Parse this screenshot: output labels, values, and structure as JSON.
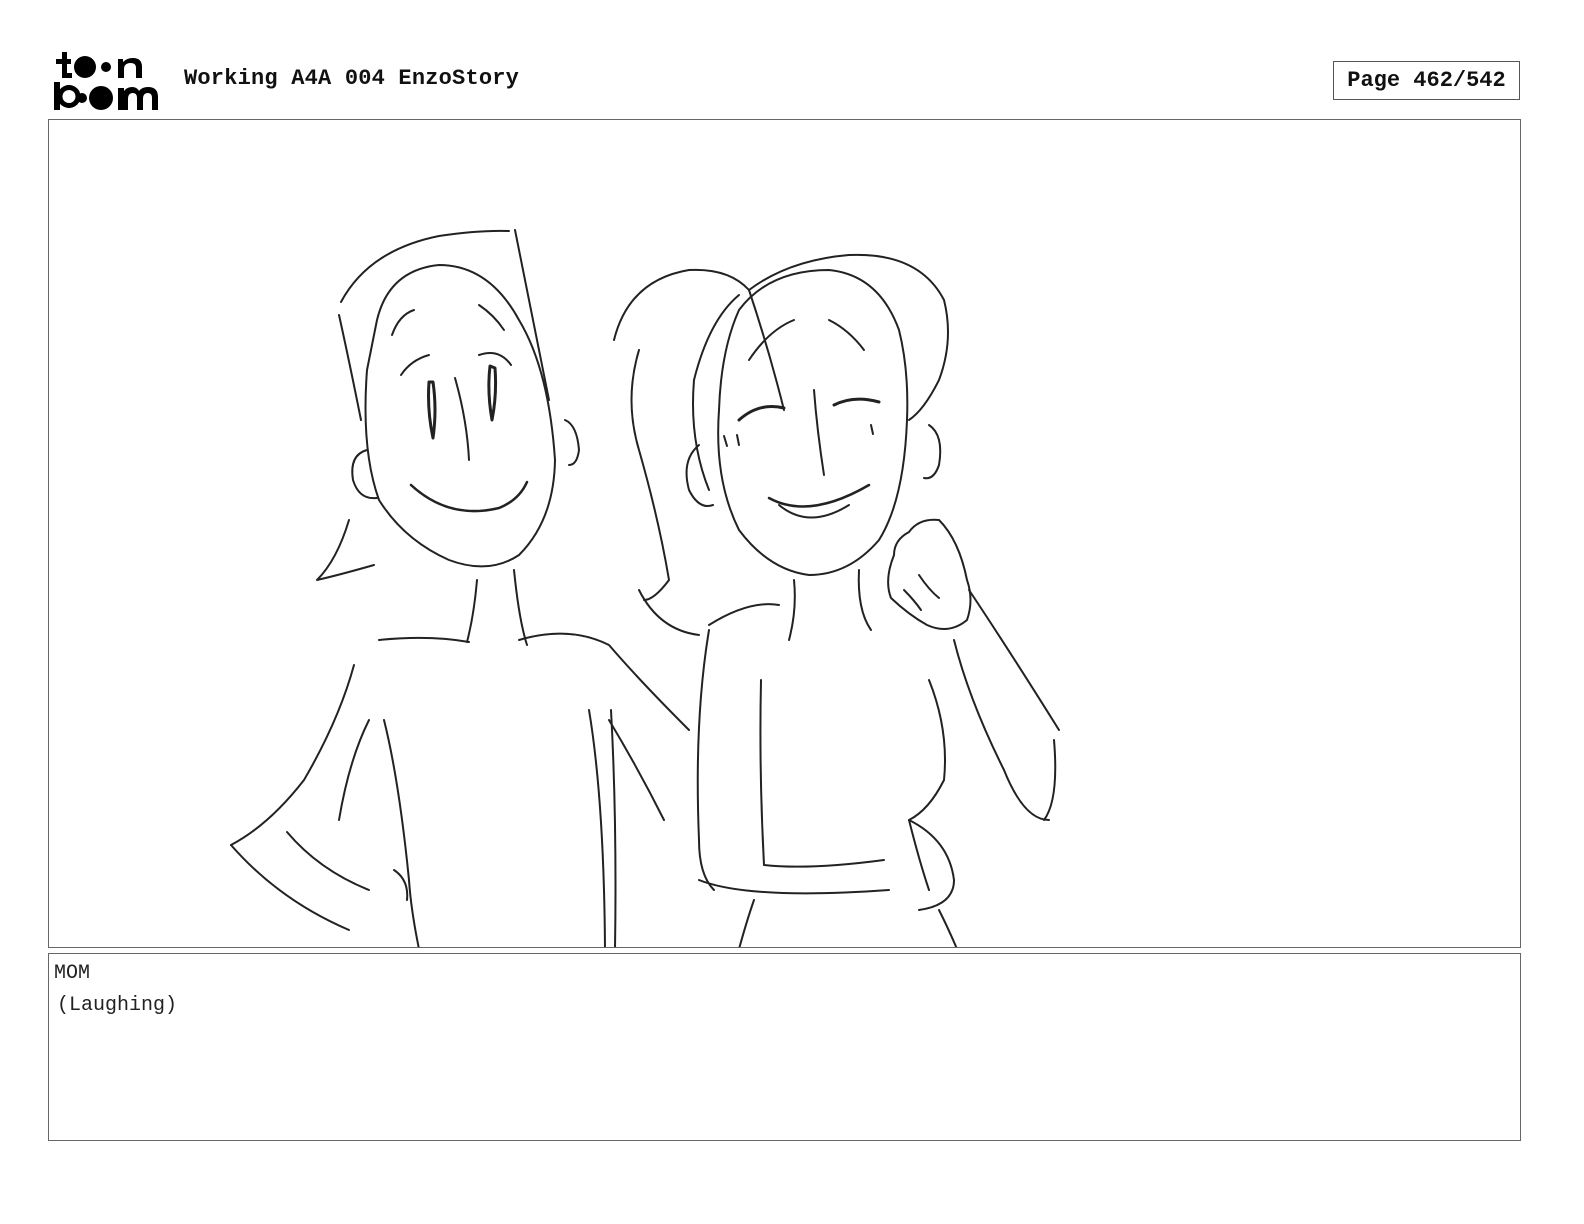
{
  "logo": {
    "line1": "toon",
    "line2": "boom",
    "icon": "toonboom-logo"
  },
  "header": {
    "title": "Working A4A 004 EnzoStory"
  },
  "page_indicator": {
    "label": "Page 462/542"
  },
  "panel": {
    "illustration": "storyboard-sketch"
  },
  "dialogue": {
    "character": "MOM",
    "parenthetical": "(Laughing)"
  }
}
